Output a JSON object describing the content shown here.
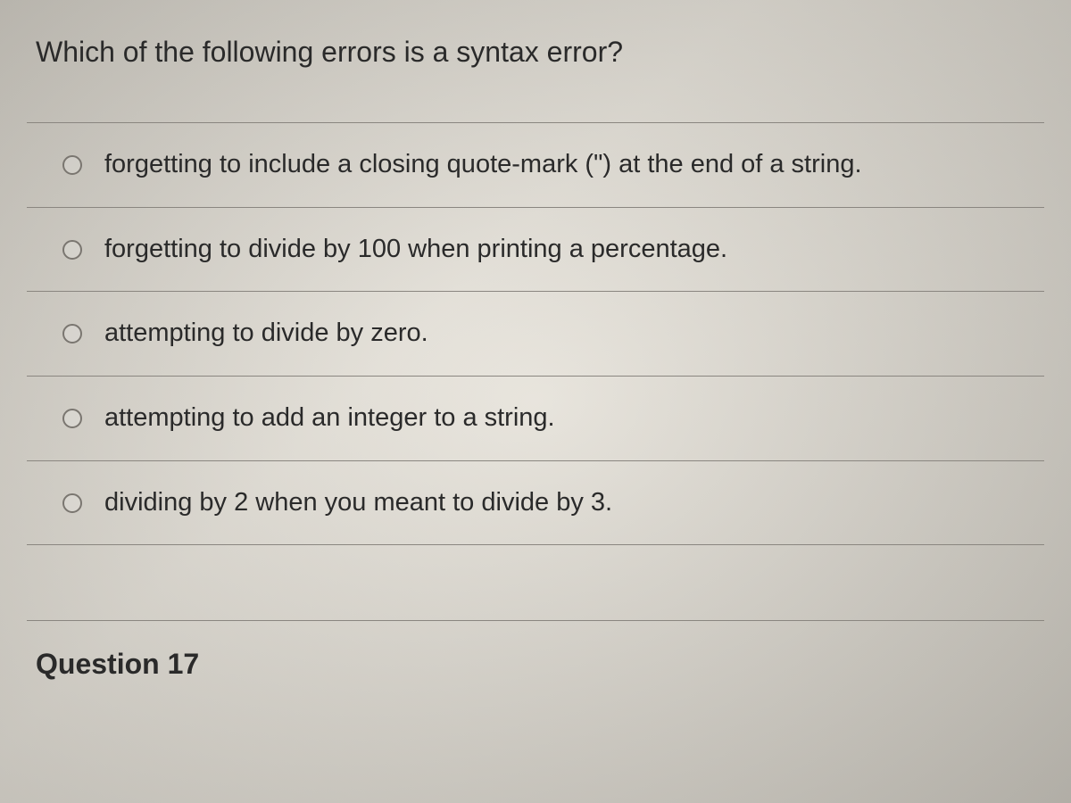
{
  "question": {
    "prompt": "Which of the following errors is a syntax error?",
    "options": [
      {
        "label": "forgetting to include a closing quote-mark (\") at the end of a string."
      },
      {
        "label": "forgetting to divide by 100 when printing a percentage."
      },
      {
        "label": "attempting to divide by zero."
      },
      {
        "label": "attempting to add an integer to a string."
      },
      {
        "label": "dividing by 2 when you meant to divide by 3."
      }
    ]
  },
  "next_question_label": "Question 17"
}
